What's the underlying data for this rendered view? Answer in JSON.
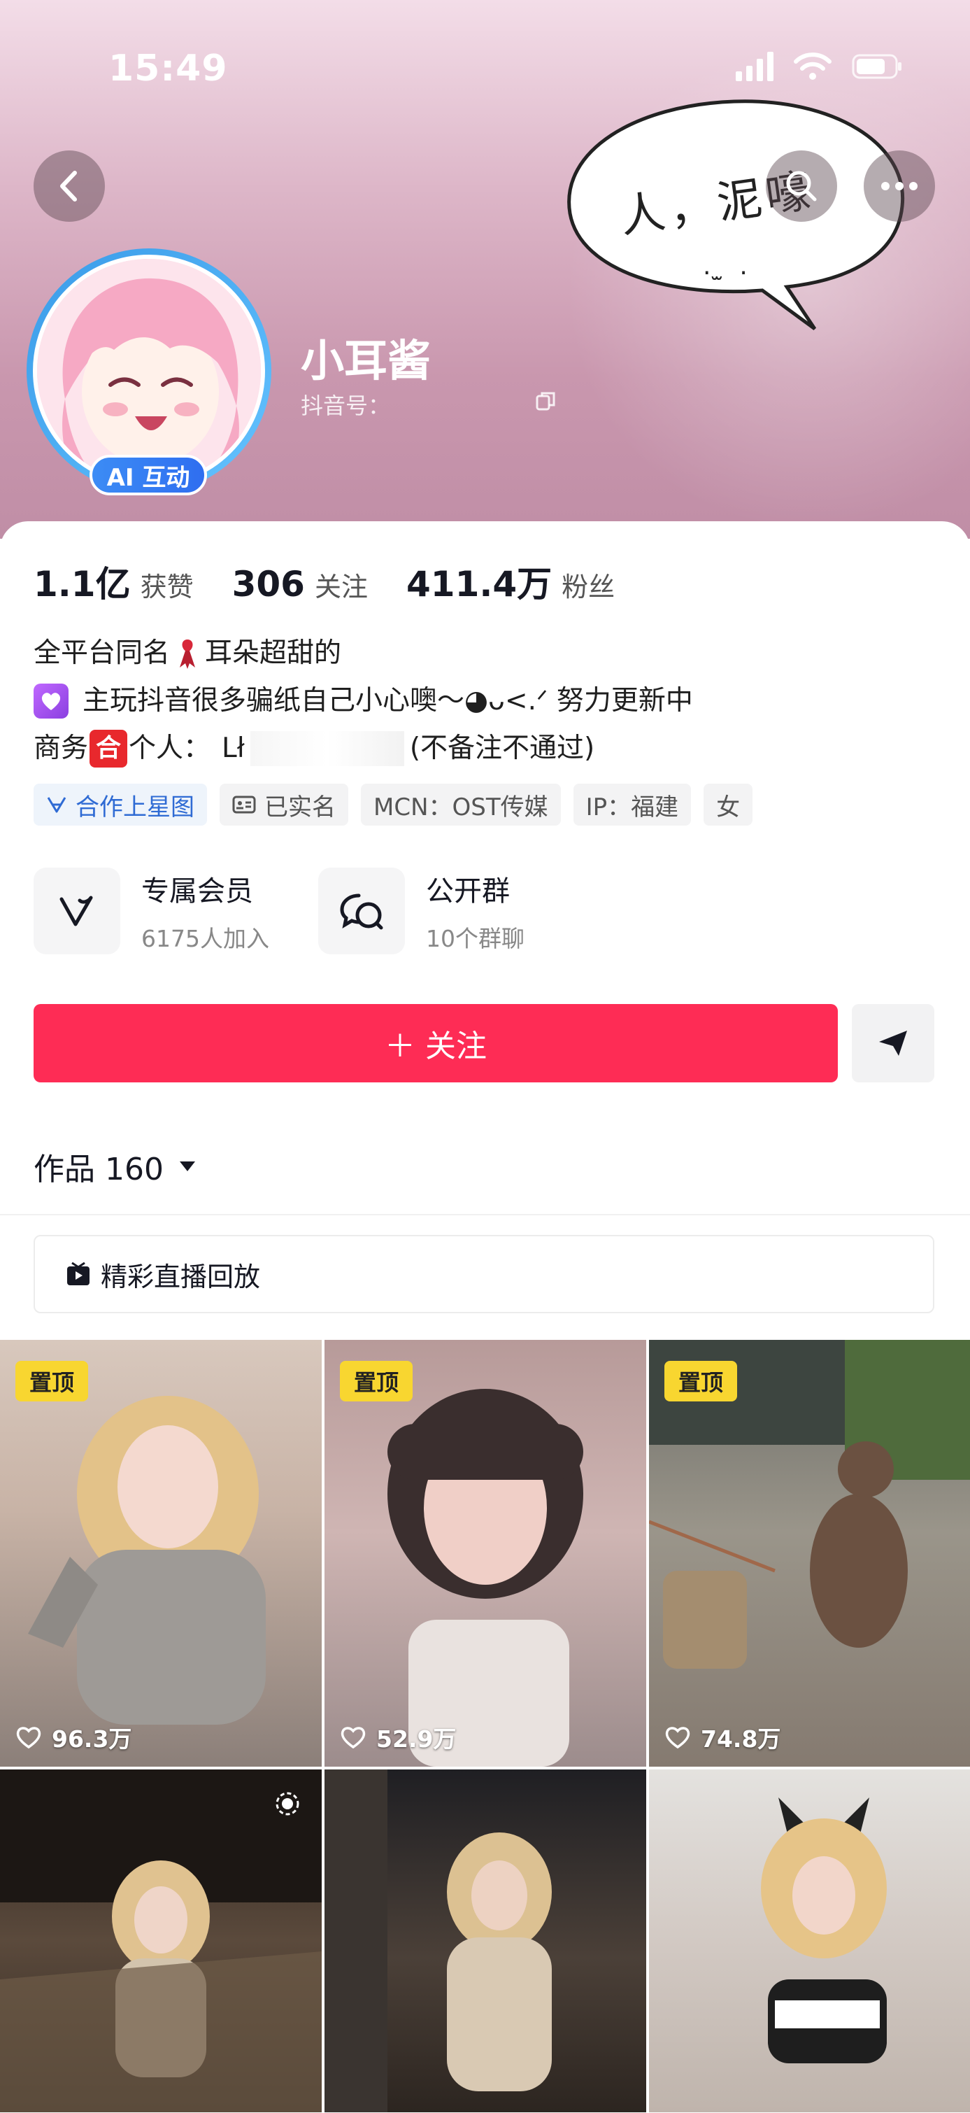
{
  "status_bar": {
    "time": "15:49"
  },
  "header": {
    "bubble_text": "人，泥嚎",
    "bubble_face": ". ̫ .",
    "nickname": "小耳酱",
    "douyin_id": "抖音号：",
    "ai_badge": "AI 互动"
  },
  "stats": [
    {
      "value": "1.1亿",
      "label": "获赞"
    },
    {
      "value": "306",
      "label": "关注"
    },
    {
      "value": "411.4万",
      "label": "粉丝"
    }
  ],
  "bio": {
    "line1_a": "全平台同名",
    "line1_b": "耳朵超甜的",
    "line2": "主玩抖音很多骗纸自己小心噢～◕ᴗ<.ᐟ 努力更新中",
    "line3_a": "商务",
    "line3_badge": "合",
    "line3_b": "个人：",
    "line3_c": "Lł",
    "line3_d": "(不备注不通过)"
  },
  "tags": [
    "合作上星图",
    "已实名",
    "MCN：OST传媒",
    "IP：福建",
    "女"
  ],
  "entries": [
    {
      "title": "专属会员",
      "sub": "6175人加入"
    },
    {
      "title": "公开群",
      "sub": "10个群聊"
    }
  ],
  "follow_label": "＋ 关注",
  "works_tab": {
    "label": "作品 160"
  },
  "live_replay": "精彩直播回放",
  "videos": [
    {
      "pinned": true,
      "pin_label": "置顶",
      "likes": "96.3万"
    },
    {
      "pinned": true,
      "pin_label": "置顶",
      "likes": "52.9万"
    },
    {
      "pinned": true,
      "pin_label": "置顶",
      "likes": "74.8万"
    },
    {
      "pinned": false,
      "likes": ""
    },
    {
      "pinned": false,
      "likes": ""
    },
    {
      "pinned": false,
      "likes": ""
    }
  ],
  "colors": {
    "accent": "#fe2c55",
    "pin": "#f8d630",
    "ai_badge": "#3c8cf5"
  }
}
